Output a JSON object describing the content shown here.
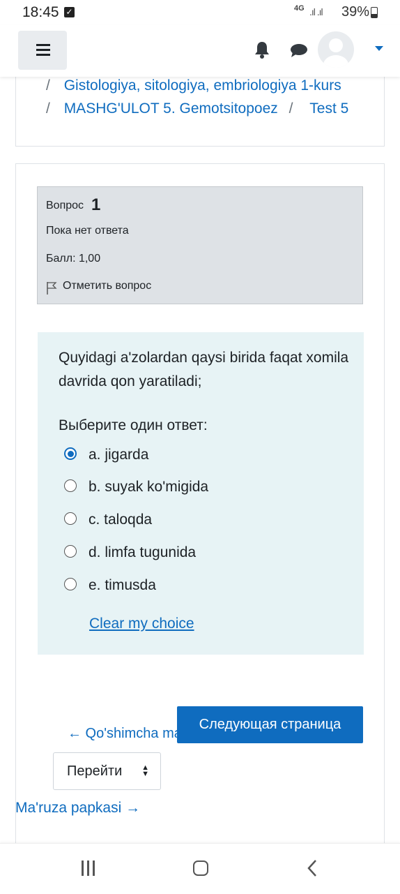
{
  "status_bar": {
    "time": "18:45",
    "network": "4G",
    "battery": "39%"
  },
  "navbar": {
    "menu_icon": "hamburger-icon",
    "notifications_icon": "bell-icon",
    "messages_icon": "chat-icon",
    "user_icon": "avatar"
  },
  "breadcrumb": {
    "course": "Gistologiya, sitologiya, embriologiya 1-kurs",
    "section": "MASHG'ULOT 5. Gemotsitopoez",
    "quiz": "Test 5",
    "separator": "/"
  },
  "question_info": {
    "label": "Вопрос",
    "number": "1",
    "state": "Пока нет ответа",
    "grade": "Балл: 1,00",
    "flag_label": "Отметить вопрос"
  },
  "question": {
    "text": "Quyidagi a'zolardan qaysi birida faqat xomila davrida qon yaratiladi;",
    "prompt": "Выберите один ответ:",
    "options": [
      {
        "label": "a. jigarda",
        "selected": true
      },
      {
        "label": "b. suyak ko'migida",
        "selected": false
      },
      {
        "label": "c. taloqda",
        "selected": false
      },
      {
        "label": "d. limfa tugunida",
        "selected": false
      },
      {
        "label": "e. timusda",
        "selected": false
      }
    ],
    "clear_label": "Clear my choice"
  },
  "navigation": {
    "prev_label": "← Qo'shimcha materiallar",
    "next_label": "Следующая страница",
    "jump_label": "Перейти",
    "next_activity_label": "Ma'ruza papkasi →"
  },
  "system_nav": {
    "recents": "recents-icon",
    "home": "home-icon",
    "back": "back-icon"
  },
  "colors": {
    "accent": "#0f6cbf",
    "info_bg": "#dee2e6",
    "question_bg": "#e7f3f5"
  }
}
